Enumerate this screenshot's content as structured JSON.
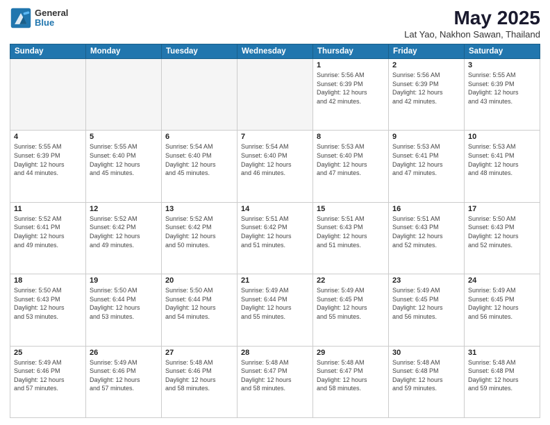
{
  "logo": {
    "general": "General",
    "blue": "Blue"
  },
  "title": "May 2025",
  "location": "Lat Yao, Nakhon Sawan, Thailand",
  "days_of_week": [
    "Sunday",
    "Monday",
    "Tuesday",
    "Wednesday",
    "Thursday",
    "Friday",
    "Saturday"
  ],
  "weeks": [
    [
      {
        "day": "",
        "info": ""
      },
      {
        "day": "",
        "info": ""
      },
      {
        "day": "",
        "info": ""
      },
      {
        "day": "",
        "info": ""
      },
      {
        "day": "1",
        "info": "Sunrise: 5:56 AM\nSunset: 6:39 PM\nDaylight: 12 hours\nand 42 minutes."
      },
      {
        "day": "2",
        "info": "Sunrise: 5:56 AM\nSunset: 6:39 PM\nDaylight: 12 hours\nand 42 minutes."
      },
      {
        "day": "3",
        "info": "Sunrise: 5:55 AM\nSunset: 6:39 PM\nDaylight: 12 hours\nand 43 minutes."
      }
    ],
    [
      {
        "day": "4",
        "info": "Sunrise: 5:55 AM\nSunset: 6:39 PM\nDaylight: 12 hours\nand 44 minutes."
      },
      {
        "day": "5",
        "info": "Sunrise: 5:55 AM\nSunset: 6:40 PM\nDaylight: 12 hours\nand 45 minutes."
      },
      {
        "day": "6",
        "info": "Sunrise: 5:54 AM\nSunset: 6:40 PM\nDaylight: 12 hours\nand 45 minutes."
      },
      {
        "day": "7",
        "info": "Sunrise: 5:54 AM\nSunset: 6:40 PM\nDaylight: 12 hours\nand 46 minutes."
      },
      {
        "day": "8",
        "info": "Sunrise: 5:53 AM\nSunset: 6:40 PM\nDaylight: 12 hours\nand 47 minutes."
      },
      {
        "day": "9",
        "info": "Sunrise: 5:53 AM\nSunset: 6:41 PM\nDaylight: 12 hours\nand 47 minutes."
      },
      {
        "day": "10",
        "info": "Sunrise: 5:53 AM\nSunset: 6:41 PM\nDaylight: 12 hours\nand 48 minutes."
      }
    ],
    [
      {
        "day": "11",
        "info": "Sunrise: 5:52 AM\nSunset: 6:41 PM\nDaylight: 12 hours\nand 49 minutes."
      },
      {
        "day": "12",
        "info": "Sunrise: 5:52 AM\nSunset: 6:42 PM\nDaylight: 12 hours\nand 49 minutes."
      },
      {
        "day": "13",
        "info": "Sunrise: 5:52 AM\nSunset: 6:42 PM\nDaylight: 12 hours\nand 50 minutes."
      },
      {
        "day": "14",
        "info": "Sunrise: 5:51 AM\nSunset: 6:42 PM\nDaylight: 12 hours\nand 51 minutes."
      },
      {
        "day": "15",
        "info": "Sunrise: 5:51 AM\nSunset: 6:43 PM\nDaylight: 12 hours\nand 51 minutes."
      },
      {
        "day": "16",
        "info": "Sunrise: 5:51 AM\nSunset: 6:43 PM\nDaylight: 12 hours\nand 52 minutes."
      },
      {
        "day": "17",
        "info": "Sunrise: 5:50 AM\nSunset: 6:43 PM\nDaylight: 12 hours\nand 52 minutes."
      }
    ],
    [
      {
        "day": "18",
        "info": "Sunrise: 5:50 AM\nSunset: 6:43 PM\nDaylight: 12 hours\nand 53 minutes."
      },
      {
        "day": "19",
        "info": "Sunrise: 5:50 AM\nSunset: 6:44 PM\nDaylight: 12 hours\nand 53 minutes."
      },
      {
        "day": "20",
        "info": "Sunrise: 5:50 AM\nSunset: 6:44 PM\nDaylight: 12 hours\nand 54 minutes."
      },
      {
        "day": "21",
        "info": "Sunrise: 5:49 AM\nSunset: 6:44 PM\nDaylight: 12 hours\nand 55 minutes."
      },
      {
        "day": "22",
        "info": "Sunrise: 5:49 AM\nSunset: 6:45 PM\nDaylight: 12 hours\nand 55 minutes."
      },
      {
        "day": "23",
        "info": "Sunrise: 5:49 AM\nSunset: 6:45 PM\nDaylight: 12 hours\nand 56 minutes."
      },
      {
        "day": "24",
        "info": "Sunrise: 5:49 AM\nSunset: 6:45 PM\nDaylight: 12 hours\nand 56 minutes."
      }
    ],
    [
      {
        "day": "25",
        "info": "Sunrise: 5:49 AM\nSunset: 6:46 PM\nDaylight: 12 hours\nand 57 minutes."
      },
      {
        "day": "26",
        "info": "Sunrise: 5:49 AM\nSunset: 6:46 PM\nDaylight: 12 hours\nand 57 minutes."
      },
      {
        "day": "27",
        "info": "Sunrise: 5:48 AM\nSunset: 6:46 PM\nDaylight: 12 hours\nand 58 minutes."
      },
      {
        "day": "28",
        "info": "Sunrise: 5:48 AM\nSunset: 6:47 PM\nDaylight: 12 hours\nand 58 minutes."
      },
      {
        "day": "29",
        "info": "Sunrise: 5:48 AM\nSunset: 6:47 PM\nDaylight: 12 hours\nand 58 minutes."
      },
      {
        "day": "30",
        "info": "Sunrise: 5:48 AM\nSunset: 6:48 PM\nDaylight: 12 hours\nand 59 minutes."
      },
      {
        "day": "31",
        "info": "Sunrise: 5:48 AM\nSunset: 6:48 PM\nDaylight: 12 hours\nand 59 minutes."
      }
    ]
  ]
}
